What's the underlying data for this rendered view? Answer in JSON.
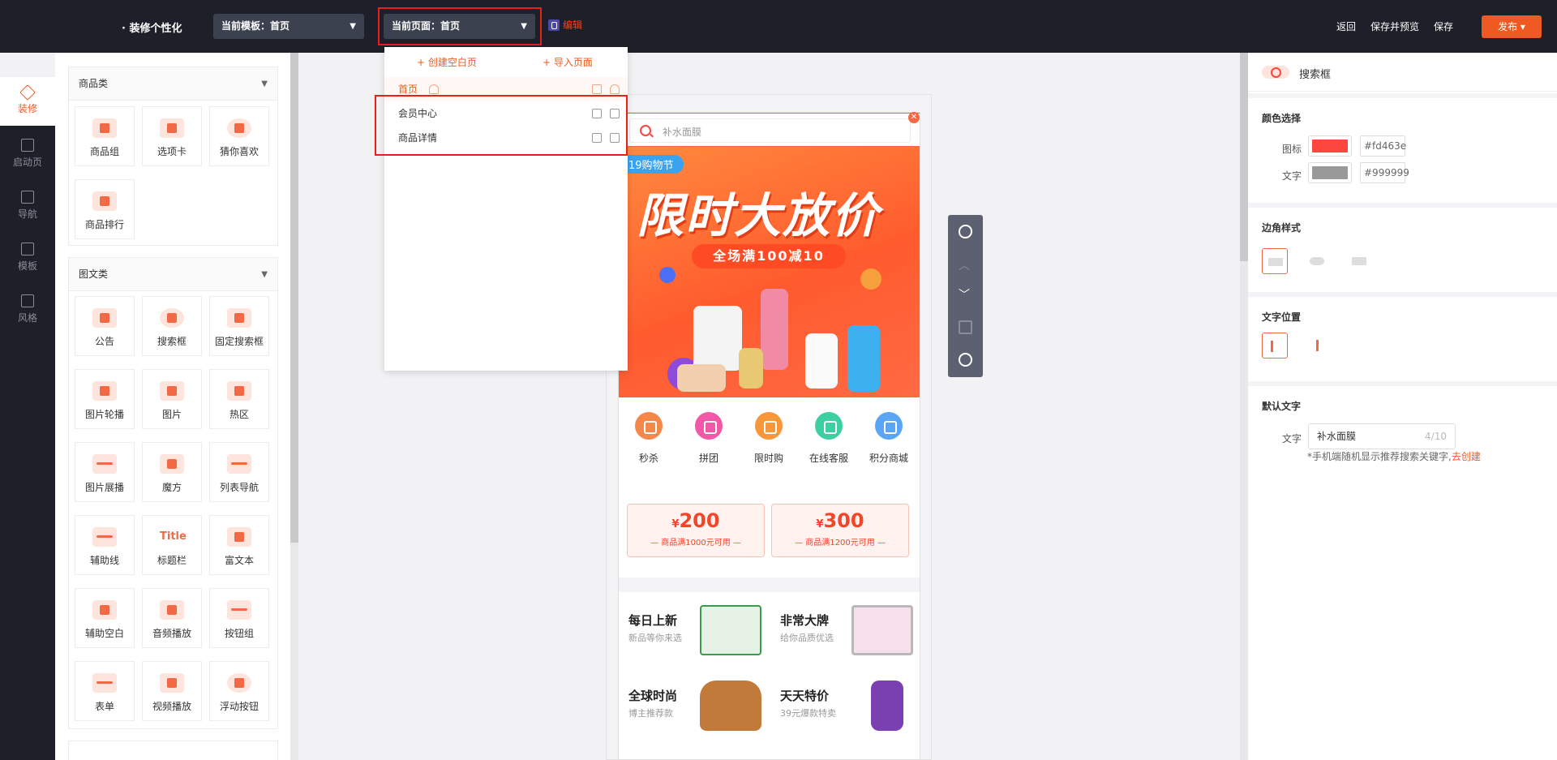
{
  "topbar": {
    "brand": "· 装修个性化",
    "template_select": "当前模板：首页",
    "page_select": "当前页面：首页",
    "edit_label": "编辑",
    "back": "返回",
    "save_preview": "保存并预览",
    "save": "保存",
    "publish": "发布"
  },
  "leftnav": {
    "items": [
      {
        "label": "装修",
        "active": true
      },
      {
        "label": "启动页"
      },
      {
        "label": "导航"
      },
      {
        "label": "模板"
      },
      {
        "label": "风格"
      }
    ]
  },
  "components": {
    "group1": {
      "title": "商品类",
      "items": [
        "商品组",
        "选项卡",
        "猜你喜欢",
        "商品排行"
      ]
    },
    "group2": {
      "title": "图文类",
      "items": [
        "公告",
        "搜索框",
        "固定搜索框",
        "图片轮播",
        "图片",
        "热区",
        "图片展播",
        "魔方",
        "列表导航",
        "辅助线",
        "标题栏",
        "富文本",
        "辅助空白",
        "音频播放",
        "按钮组",
        "表单",
        "视频播放",
        "浮动按钮"
      ],
      "title_icon_text": "Title"
    }
  },
  "dropdown": {
    "create_blank": "+ 创建空白页",
    "import_page": "+ 导入页面",
    "pages": [
      "首页",
      "会员中心",
      "商品详情"
    ]
  },
  "phone": {
    "search_placeholder": "补水面膜",
    "banner": {
      "tag": "19购物节",
      "headline": "限时大放价",
      "subline": "全场满100减10"
    },
    "icons": [
      {
        "label": "秒杀",
        "color": "#f5874a"
      },
      {
        "label": "拼团",
        "color": "#f257a8"
      },
      {
        "label": "限时购",
        "color": "#f8973a"
      },
      {
        "label": "在线客服",
        "color": "#3dcfa2"
      },
      {
        "label": "积分商城",
        "color": "#5aa5f5"
      }
    ],
    "coupons": [
      {
        "currency": "¥",
        "amount": "200",
        "cond": "— 商品满1000元可用 —"
      },
      {
        "currency": "¥",
        "amount": "300",
        "cond": "— 商品满1200元可用 —"
      }
    ],
    "cubes": [
      {
        "title": "每日上新",
        "sub": "新品等你来选"
      },
      {
        "title": "非常大牌",
        "sub": "给你品质优选"
      },
      {
        "title": "全球时尚",
        "sub": "博主推荐款"
      },
      {
        "title": "天天特价",
        "sub": "39元爆款特卖"
      }
    ]
  },
  "rightpanel": {
    "header": "搜索框",
    "color_section": {
      "title": "颜色选择",
      "icon_label": "图标",
      "icon_color": "#fd463e",
      "text_label": "文字",
      "text_color": "#999999"
    },
    "corner_section": {
      "title": "边角样式"
    },
    "position_section": {
      "title": "文字位置"
    },
    "default_text_section": {
      "title": "默认文字",
      "label": "文字",
      "value": "补水面膜",
      "count": "4/10",
      "hint": "*手机端随机显示推荐搜索关键字,",
      "hint_link": "去创建"
    }
  }
}
